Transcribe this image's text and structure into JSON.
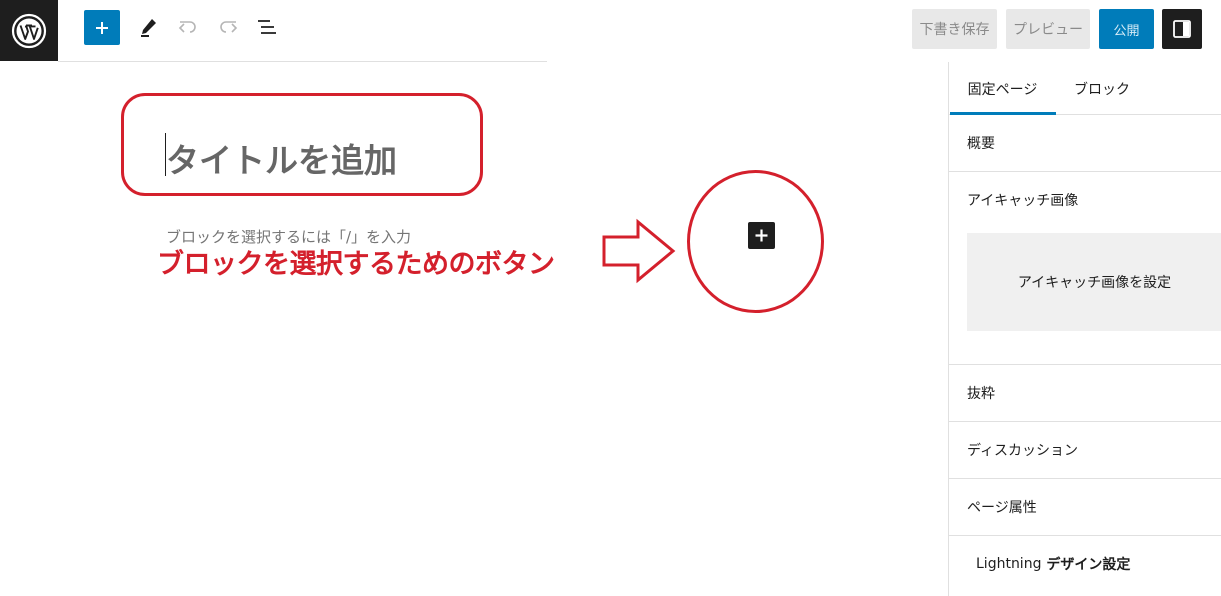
{
  "toolbar": {
    "add_block_icon": "plus-icon",
    "tools_icon": "pen-icon",
    "undo_icon": "undo-icon",
    "redo_icon": "redo-icon",
    "outline_icon": "list-view-icon",
    "save_draft_label": "下書き保存",
    "preview_label": "プレビュー",
    "publish_label": "公開",
    "settings_icon": "sidebar-toggle-icon"
  },
  "editor": {
    "title_placeholder": "タイトルを追加",
    "block_placeholder": "ブロックを選択するには「/」を入力",
    "inline_add_icon": "plus-icon"
  },
  "annotation": {
    "label": "ブロックを選択するためのボタン",
    "color": "#d4202c"
  },
  "sidebar": {
    "tabs": [
      {
        "label": "固定ページ",
        "active": true
      },
      {
        "label": "ブロック",
        "active": false
      }
    ],
    "panels": {
      "summary": "概要",
      "featured_image": "アイキャッチ画像",
      "featured_image_button": "アイキャッチ画像を設定",
      "excerpt": "抜粋",
      "discussion": "ディスカッション",
      "page_attributes": "ページ属性",
      "lightning_prefix": "Lightning",
      "lightning_suffix": " デザイン設定"
    }
  },
  "colors": {
    "accent": "#007cba",
    "dark": "#1e1e1e",
    "annotation": "#d4202c"
  }
}
